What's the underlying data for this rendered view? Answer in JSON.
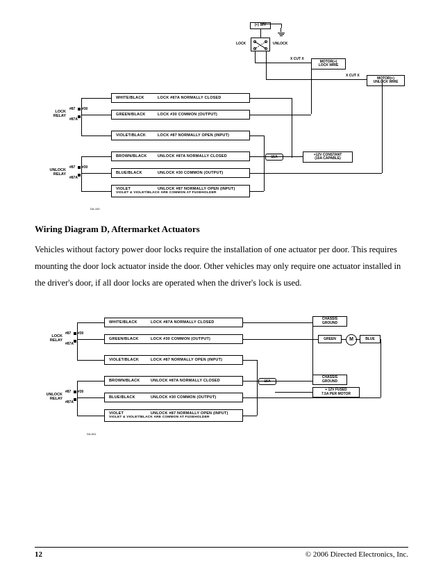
{
  "heading": "Wiring Diagram D, Aftermarket Actuators",
  "body_text": "Vehicles without factory power door locks require the installation of one actuator per door. This requires mounting the door lock actuator inside the door. Other vehicles may only require one actuator installed in the driver's door, if all door locks are operated when the driver's lock is used.",
  "footer": {
    "page": "12",
    "copyright": "© 2006 Directed Electronics, Inc."
  },
  "diagram_top": {
    "fig_id": "DA-100",
    "relay_lock_label": "LOCK\nRELAY",
    "relay_unlock_label": "UNLOCK\nRELAY",
    "pins": {
      "p87": "#87",
      "p30": "#30",
      "p87a": "#87A"
    },
    "rows_lock": [
      {
        "color": "WHITE/BLACK",
        "desc": "LOCK #87A NORMALLY CLOSED"
      },
      {
        "color": "GREEN/BLACK",
        "desc": "LOCK #30 COMMON (OUTPUT)"
      },
      {
        "color": "VIOLET/BLACK",
        "desc": "LOCK #87 NORMALLY OPEN (INPUT)"
      }
    ],
    "rows_unlock": [
      {
        "color": "BROWN/BLACK",
        "desc": "UNLOCK #87A NORMALLY CLOSED"
      },
      {
        "color": "BLUE/BLACK",
        "desc": "UNLOCK #30 COMMON (OUTPUT)"
      },
      {
        "color": "VIOLET",
        "desc": "UNLOCK #87 NORMALLY OPEN (INPUT)"
      }
    ],
    "violet_note": "VIOLET & VIOLET/BLACK ARE COMMON AT FUSEHOLDER",
    "fuse": "15A",
    "constant_box": "+12V CONSTANT\n(15A CAPABLE)",
    "top_labels": {
      "plus12": "(+) 12V",
      "lock": "LOCK",
      "unlock": "UNLOCK"
    },
    "cut_x": "X CUT X",
    "motor_lock": "MOTOR(+)\nLOCK WIRE",
    "motor_unlock": "MOTOR(+)\nUNLOCK WIRE"
  },
  "diagram_bottom": {
    "fig_id": "DA-541",
    "relay_lock_label": "LOCK\nRELAY",
    "relay_unlock_label": "UNLOCK\nRELAY",
    "pins": {
      "p87": "#87",
      "p30": "#30",
      "p87a": "#87A"
    },
    "rows_lock": [
      {
        "color": "WHITE/BLACK",
        "desc": "LOCK #87A NORMALLY CLOSED"
      },
      {
        "color": "GREEN/BLACK",
        "desc": "LOCK #30 COMMON (OUTPUT)"
      },
      {
        "color": "VIOLET/BLACK",
        "desc": "LOCK #87 NORMALLY OPEN (INPUT)"
      }
    ],
    "rows_unlock": [
      {
        "color": "BROWN/BLACK",
        "desc": "UNLOCK #87A NORMALLY CLOSED"
      },
      {
        "color": "BLUE/BLACK",
        "desc": "UNLOCK #30 COMMON (OUTPUT)"
      },
      {
        "color": "VIOLET",
        "desc": "UNLOCK #87 NORMALLY OPEN (INPUT)"
      }
    ],
    "violet_note": "VIOLET & VIOLET/BLACK ARE COMMON AT FUSEHOLDER",
    "fuse": "15A",
    "chassis_ground_1": "CHASSIS\nGROUND",
    "chassis_ground_2": "CHASSIS\nGROUND",
    "fused_box": "+ 12V FUSED\n7.5A PER MOTOR",
    "motor_left": "GREEN",
    "motor_right": "BLUE",
    "motor_symbol": "M"
  }
}
